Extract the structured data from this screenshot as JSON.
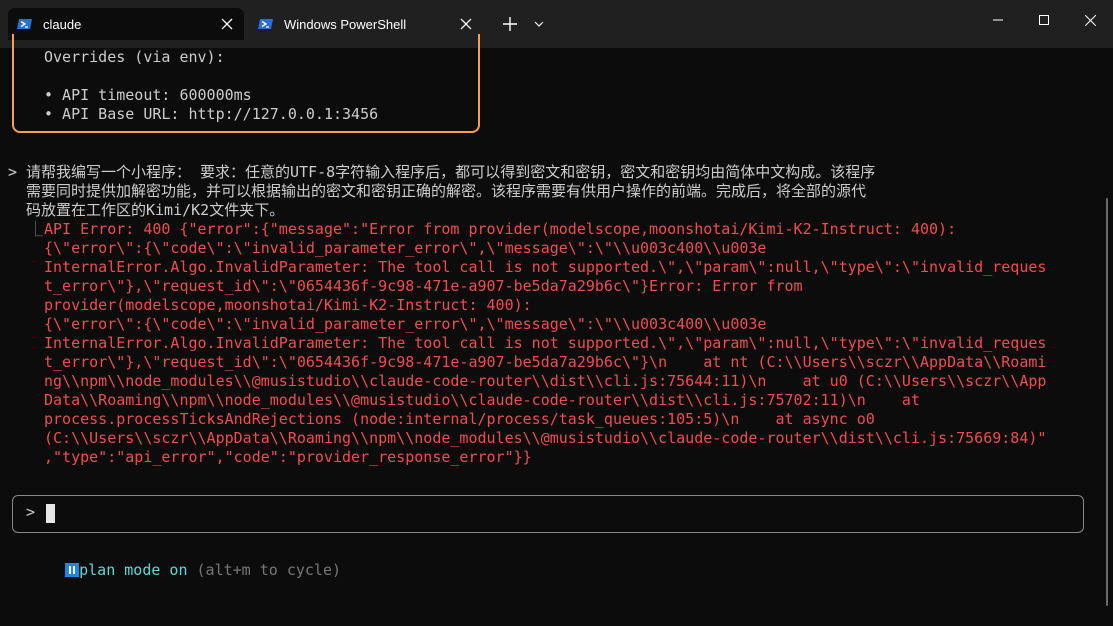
{
  "tabs": [
    {
      "label": "claude",
      "icon": "powershell-icon",
      "active": true
    },
    {
      "label": "Windows PowerShell",
      "icon": "powershell-icon",
      "active": false
    }
  ],
  "titlebar": {
    "new_tab": "+",
    "dropdown": "chevron-down-icon"
  },
  "config": {
    "overrides_heading": "Overrides (via env):",
    "timeout_line": "• API timeout: 600000ms",
    "base_url_line": "• API Base URL: http://127.0.0.1:3456"
  },
  "user_message": {
    "prompt_symbol": ">",
    "lines": [
      "请帮我编写一个小程序： 要求：任意的UTF-8字符输入程序后，都可以得到密文和密钥，密文和密钥均由简体中文构成。该程序",
      "需要同时提供加解密功能，并可以根据输出的密文和密钥正确的解密。该程序需要有供用户操作的前端。完成后，将全部的源代",
      "码放置在工作区的Kimi/K2文件夹下。"
    ]
  },
  "error_output": {
    "branch_symbol": "⎿",
    "lines": [
      "API Error: 400 {\"error\":{\"message\":\"Error from provider(modelscope,moonshotai/Kimi-K2-Instruct: 400):",
      "{\\\"error\\\":{\\\"code\\\":\\\"invalid_parameter_error\\\",\\\"message\\\":\\\"\\\\u003c400\\\\u003e",
      "InternalError.Algo.InvalidParameter: The tool call is not supported.\\\",\\\"param\\\":null,\\\"type\\\":\\\"invalid_reques",
      "t_error\\\"},\\\"request_id\\\":\\\"0654436f-9c98-471e-a907-be5da7a29b6c\\\"}Error: Error from",
      "provider(modelscope,moonshotai/Kimi-K2-Instruct: 400):",
      "{\\\"error\\\":{\\\"code\\\":\\\"invalid_parameter_error\\\",\\\"message\\\":\\\"\\\\u003c400\\\\u003e",
      "InternalError.Algo.InvalidParameter: The tool call is not supported.\\\",\\\"param\\\":null,\\\"type\\\":\\\"invalid_reques",
      "t_error\\\"},\\\"request_id\\\":\\\"0654436f-9c98-471e-a907-be5da7a29b6c\\\"}\\n    at nt (C:\\\\Users\\\\sczr\\\\AppData\\\\Roami",
      "ng\\\\npm\\\\node_modules\\\\@musistudio\\\\claude-code-router\\\\dist\\\\cli.js:75644:11)\\n    at u0 (C:\\\\Users\\\\sczr\\\\App",
      "Data\\\\Roaming\\\\npm\\\\node_modules\\\\@musistudio\\\\claude-code-router\\\\dist\\\\cli.js:75702:11)\\n    at",
      "process.processTicksAndRejections (node:internal/process/task_queues:105:5)\\n    at async o0",
      "(C:\\\\Users\\\\sczr\\\\AppData\\\\Roaming\\\\npm\\\\node_modules\\\\@musistudio\\\\claude-code-router\\\\dist\\\\cli.js:75669:84)\"",
      ",\"type\":\"api_error\",\"code\":\"provider_response_error\"}}"
    ]
  },
  "input": {
    "prompt_symbol": ">",
    "value": ""
  },
  "mode_line": {
    "mode_label": "plan mode on",
    "hint": "(alt+m to cycle)"
  },
  "colors": {
    "background": "#0c0c0c",
    "error": "#f14c4c",
    "config_border": "#f5a04a",
    "mode_badge": "#1e88e5",
    "mode_text": "#61d6d6"
  }
}
